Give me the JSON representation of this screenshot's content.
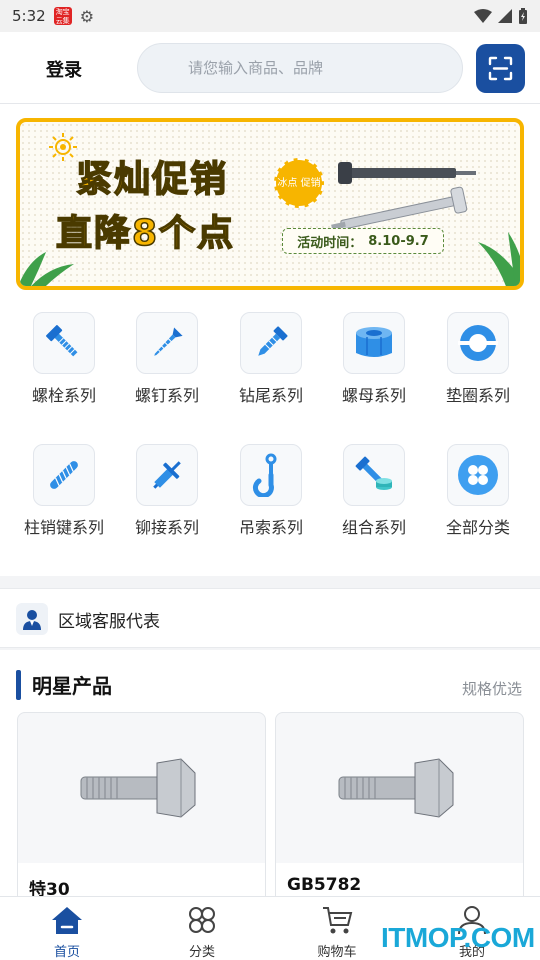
{
  "status_bar": {
    "time": "5:32",
    "app_badge": "淘宝 云集"
  },
  "header": {
    "login_label": "登录",
    "search_placeholder": "请您输入商品、品牌"
  },
  "banner": {
    "line1": "紧灿促销",
    "line2": "直降8个点",
    "badge": "冰点 促销",
    "event_label": "活动时间：",
    "event_dates": "8.10-9.7"
  },
  "categories": [
    {
      "label": "螺栓系列",
      "icon": "bolt-icon"
    },
    {
      "label": "螺钉系列",
      "icon": "screw-icon"
    },
    {
      "label": "钻尾系列",
      "icon": "drill-tail-screw-icon"
    },
    {
      "label": "螺母系列",
      "icon": "nut-icon"
    },
    {
      "label": "垫圈系列",
      "icon": "washer-icon"
    },
    {
      "label": "柱销键系列",
      "icon": "pin-key-icon"
    },
    {
      "label": "铆接系列",
      "icon": "rivet-icon"
    },
    {
      "label": "吊索系列",
      "icon": "hook-icon"
    },
    {
      "label": "组合系列",
      "icon": "bolt-nut-combo-icon"
    },
    {
      "label": "全部分类",
      "icon": "all-categories-icon"
    }
  ],
  "service": {
    "label": "区域客服代表"
  },
  "star_products": {
    "title": "明星产品",
    "more": "规格优选",
    "items": [
      {
        "name": "特30"
      },
      {
        "name": "GB5782"
      }
    ]
  },
  "tabs": [
    {
      "label": "首页",
      "icon": "home-icon",
      "active": true
    },
    {
      "label": "分类",
      "icon": "category-icon",
      "active": false
    },
    {
      "label": "购物车",
      "icon": "cart-icon",
      "active": false
    },
    {
      "label": "我的",
      "icon": "user-icon",
      "active": false
    }
  ],
  "watermark": "ITMOP.COM",
  "colors": {
    "brand_blue": "#1a4fa0",
    "icon_blue": "#2f8fe6",
    "banner_yellow": "#f7b500"
  }
}
